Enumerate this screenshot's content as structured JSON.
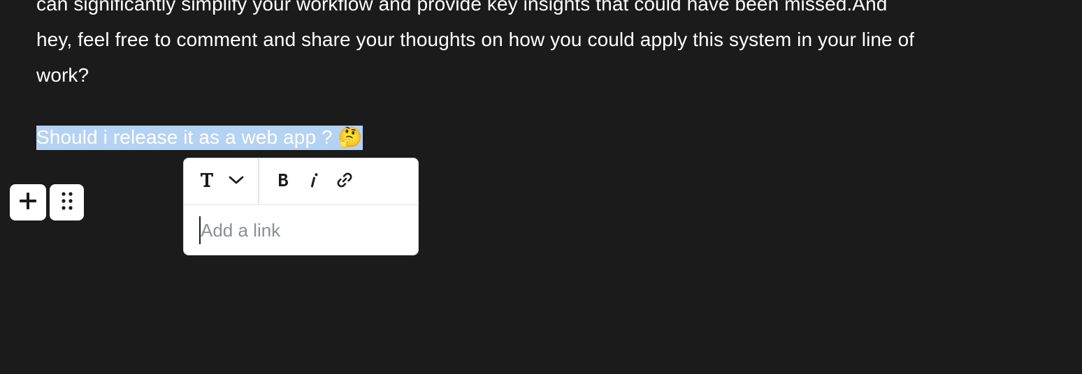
{
  "editor": {
    "paragraph1": {
      "lines": [
        "can significantly simplify your workflow and provide key insights that could have been missed.And",
        "hey, feel free to comment and share your thoughts on how you could apply this system in your line of",
        "work?"
      ]
    },
    "paragraph2": {
      "text": "Should i release it as a web app ? 🤔"
    }
  },
  "block_controls": {
    "add_icon": "plus-icon",
    "drag_icon": "drag-dots-icon"
  },
  "toolbar": {
    "text_style_icon": "text-style-icon",
    "dropdown_icon": "chevron-down-icon",
    "bold_icon": "bold-icon",
    "italic_icon": "italic-icon",
    "link_icon": "link-icon",
    "link_input": {
      "placeholder": "Add a link",
      "value": ""
    }
  },
  "colors": {
    "background": "#1b1b1b",
    "text": "#ffffff",
    "selection": "#b4d2f3",
    "toolbar_bg": "#ffffff",
    "placeholder": "#8a8f98"
  }
}
